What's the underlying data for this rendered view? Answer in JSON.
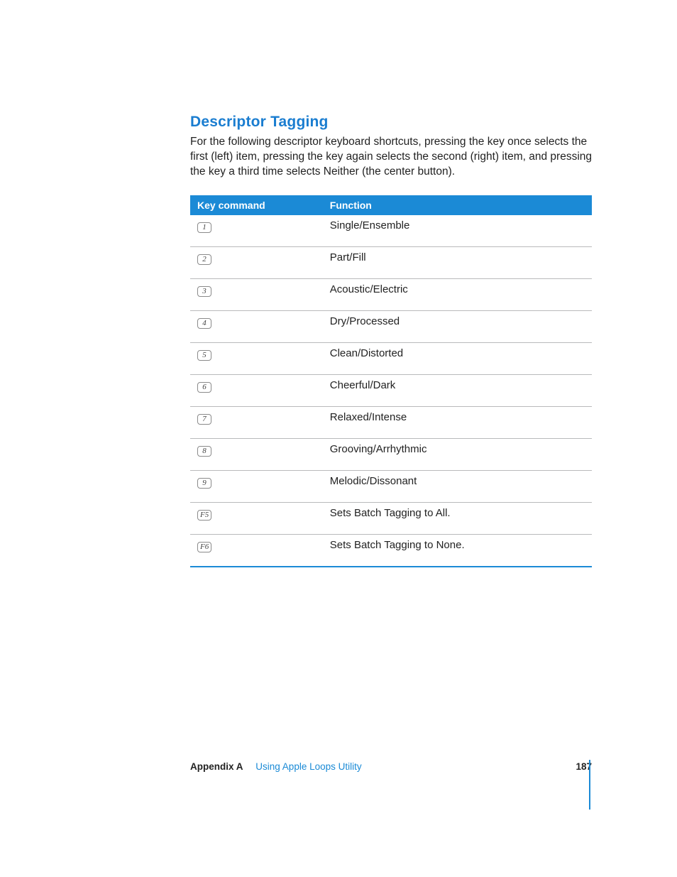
{
  "heading": "Descriptor Tagging",
  "intro": "For the following descriptor keyboard shortcuts, pressing the key once selects the first (left) item, pressing the key again selects the second (right) item, and pressing the key a third time selects Neither (the center button).",
  "table": {
    "headers": {
      "key": "Key command",
      "func": "Function"
    },
    "rows": [
      {
        "key": "1",
        "func": "Single/Ensemble"
      },
      {
        "key": "2",
        "func": "Part/Fill"
      },
      {
        "key": "3",
        "func": "Acoustic/Electric"
      },
      {
        "key": "4",
        "func": "Dry/Processed"
      },
      {
        "key": "5",
        "func": "Clean/Distorted"
      },
      {
        "key": "6",
        "func": "Cheerful/Dark"
      },
      {
        "key": "7",
        "func": "Relaxed/Intense"
      },
      {
        "key": "8",
        "func": "Grooving/Arrhythmic"
      },
      {
        "key": "9",
        "func": "Melodic/Dissonant"
      },
      {
        "key": "F5",
        "func": "Sets Batch Tagging to All."
      },
      {
        "key": "F6",
        "func": "Sets Batch Tagging to None."
      }
    ]
  },
  "footer": {
    "appendix_label": "Appendix A",
    "appendix_title": "Using Apple Loops Utility",
    "page_number": "187"
  }
}
